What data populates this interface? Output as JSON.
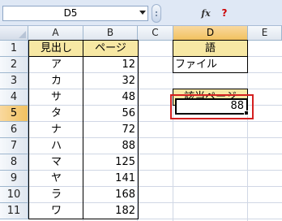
{
  "formula_bar": {
    "name_box": "D5",
    "fx_label": "fx",
    "help_label": "?"
  },
  "columns": [
    "A",
    "B",
    "C",
    "D",
    "E"
  ],
  "active_column": "D",
  "rows": [
    "1",
    "2",
    "3",
    "4",
    "5",
    "6",
    "7",
    "8",
    "9",
    "10",
    "11"
  ],
  "active_row": "5",
  "table": {
    "headers": [
      "見出し",
      "ページ"
    ],
    "rows": [
      [
        "ア",
        "12"
      ],
      [
        "カ",
        "32"
      ],
      [
        "サ",
        "48"
      ],
      [
        "タ",
        "56"
      ],
      [
        "ナ",
        "72"
      ],
      [
        "ハ",
        "88"
      ],
      [
        "マ",
        "125"
      ],
      [
        "ヤ",
        "141"
      ],
      [
        "ラ",
        "168"
      ],
      [
        "ワ",
        "182"
      ]
    ]
  },
  "lookup": {
    "word_header": "語",
    "word_value": "ファイル",
    "page_header": "該当ページ",
    "page_value": "88"
  },
  "colors": {
    "header_fill": "#f7e8a4",
    "highlight_border": "#d42020",
    "active_header": "#f1c15f"
  }
}
